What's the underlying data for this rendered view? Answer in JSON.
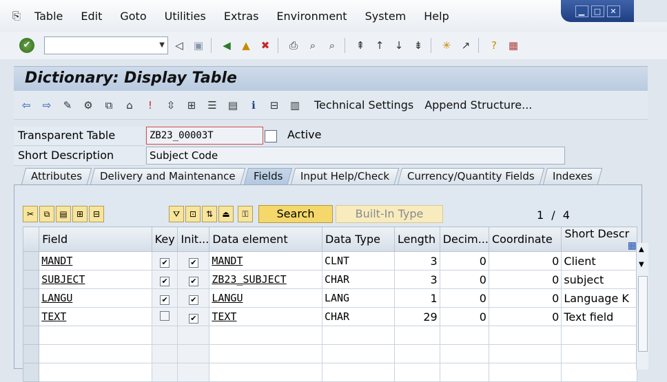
{
  "menu": {
    "items": [
      "Table",
      "Edit",
      "Goto",
      "Utilities",
      "Extras",
      "Environment",
      "System",
      "Help"
    ]
  },
  "window_controls": [
    "minimize",
    "maximize",
    "close"
  ],
  "command_field": {
    "value": ""
  },
  "title": "Dictionary: Display Table",
  "app_toolbar": {
    "technical_settings": "Technical Settings",
    "append_structure": "Append Structure..."
  },
  "header": {
    "table_label": "Transparent Table",
    "table_value": "ZB23_00003T",
    "status": "Active",
    "short_desc_label": "Short Description",
    "short_desc_value": "Subject Code"
  },
  "tabs": [
    "Attributes",
    "Delivery and Maintenance",
    "Fields",
    "Input Help/Check",
    "Currency/Quantity Fields",
    "Indexes"
  ],
  "active_tab": "Fields",
  "grid_toolbar": {
    "search": "Search",
    "builtin_type": "Built-In Type",
    "page": "1",
    "page_sep": "/",
    "page_total": "4"
  },
  "table": {
    "columns": [
      "Field",
      "Key",
      "Init...",
      "Data element",
      "Data Type",
      "Length",
      "Decim...",
      "Coordinate",
      "Short Descr"
    ],
    "rows": [
      {
        "field": "MANDT",
        "key": true,
        "init": true,
        "data_element": "MANDT",
        "data_type": "CLNT",
        "length": "3",
        "decimals": "0",
        "coordinate": "0",
        "short_desc": "Client"
      },
      {
        "field": "SUBJECT",
        "key": true,
        "init": true,
        "data_element": "ZB23_SUBJECT",
        "data_type": "CHAR",
        "length": "3",
        "decimals": "0",
        "coordinate": "0",
        "short_desc": "subject"
      },
      {
        "field": "LANGU",
        "key": true,
        "init": true,
        "data_element": "LANGU",
        "data_type": "LANG",
        "length": "1",
        "decimals": "0",
        "coordinate": "0",
        "short_desc": "Language K"
      },
      {
        "field": "TEXT",
        "key": false,
        "init": true,
        "data_element": "TEXT",
        "data_type": "CHAR",
        "length": "29",
        "decimals": "0",
        "coordinate": "0",
        "short_desc": "Text field"
      }
    ]
  },
  "colors": {
    "title_bg": "#b9cbe0",
    "search_btn": "#f4d86b",
    "window_ctl": "#1f3e82"
  }
}
